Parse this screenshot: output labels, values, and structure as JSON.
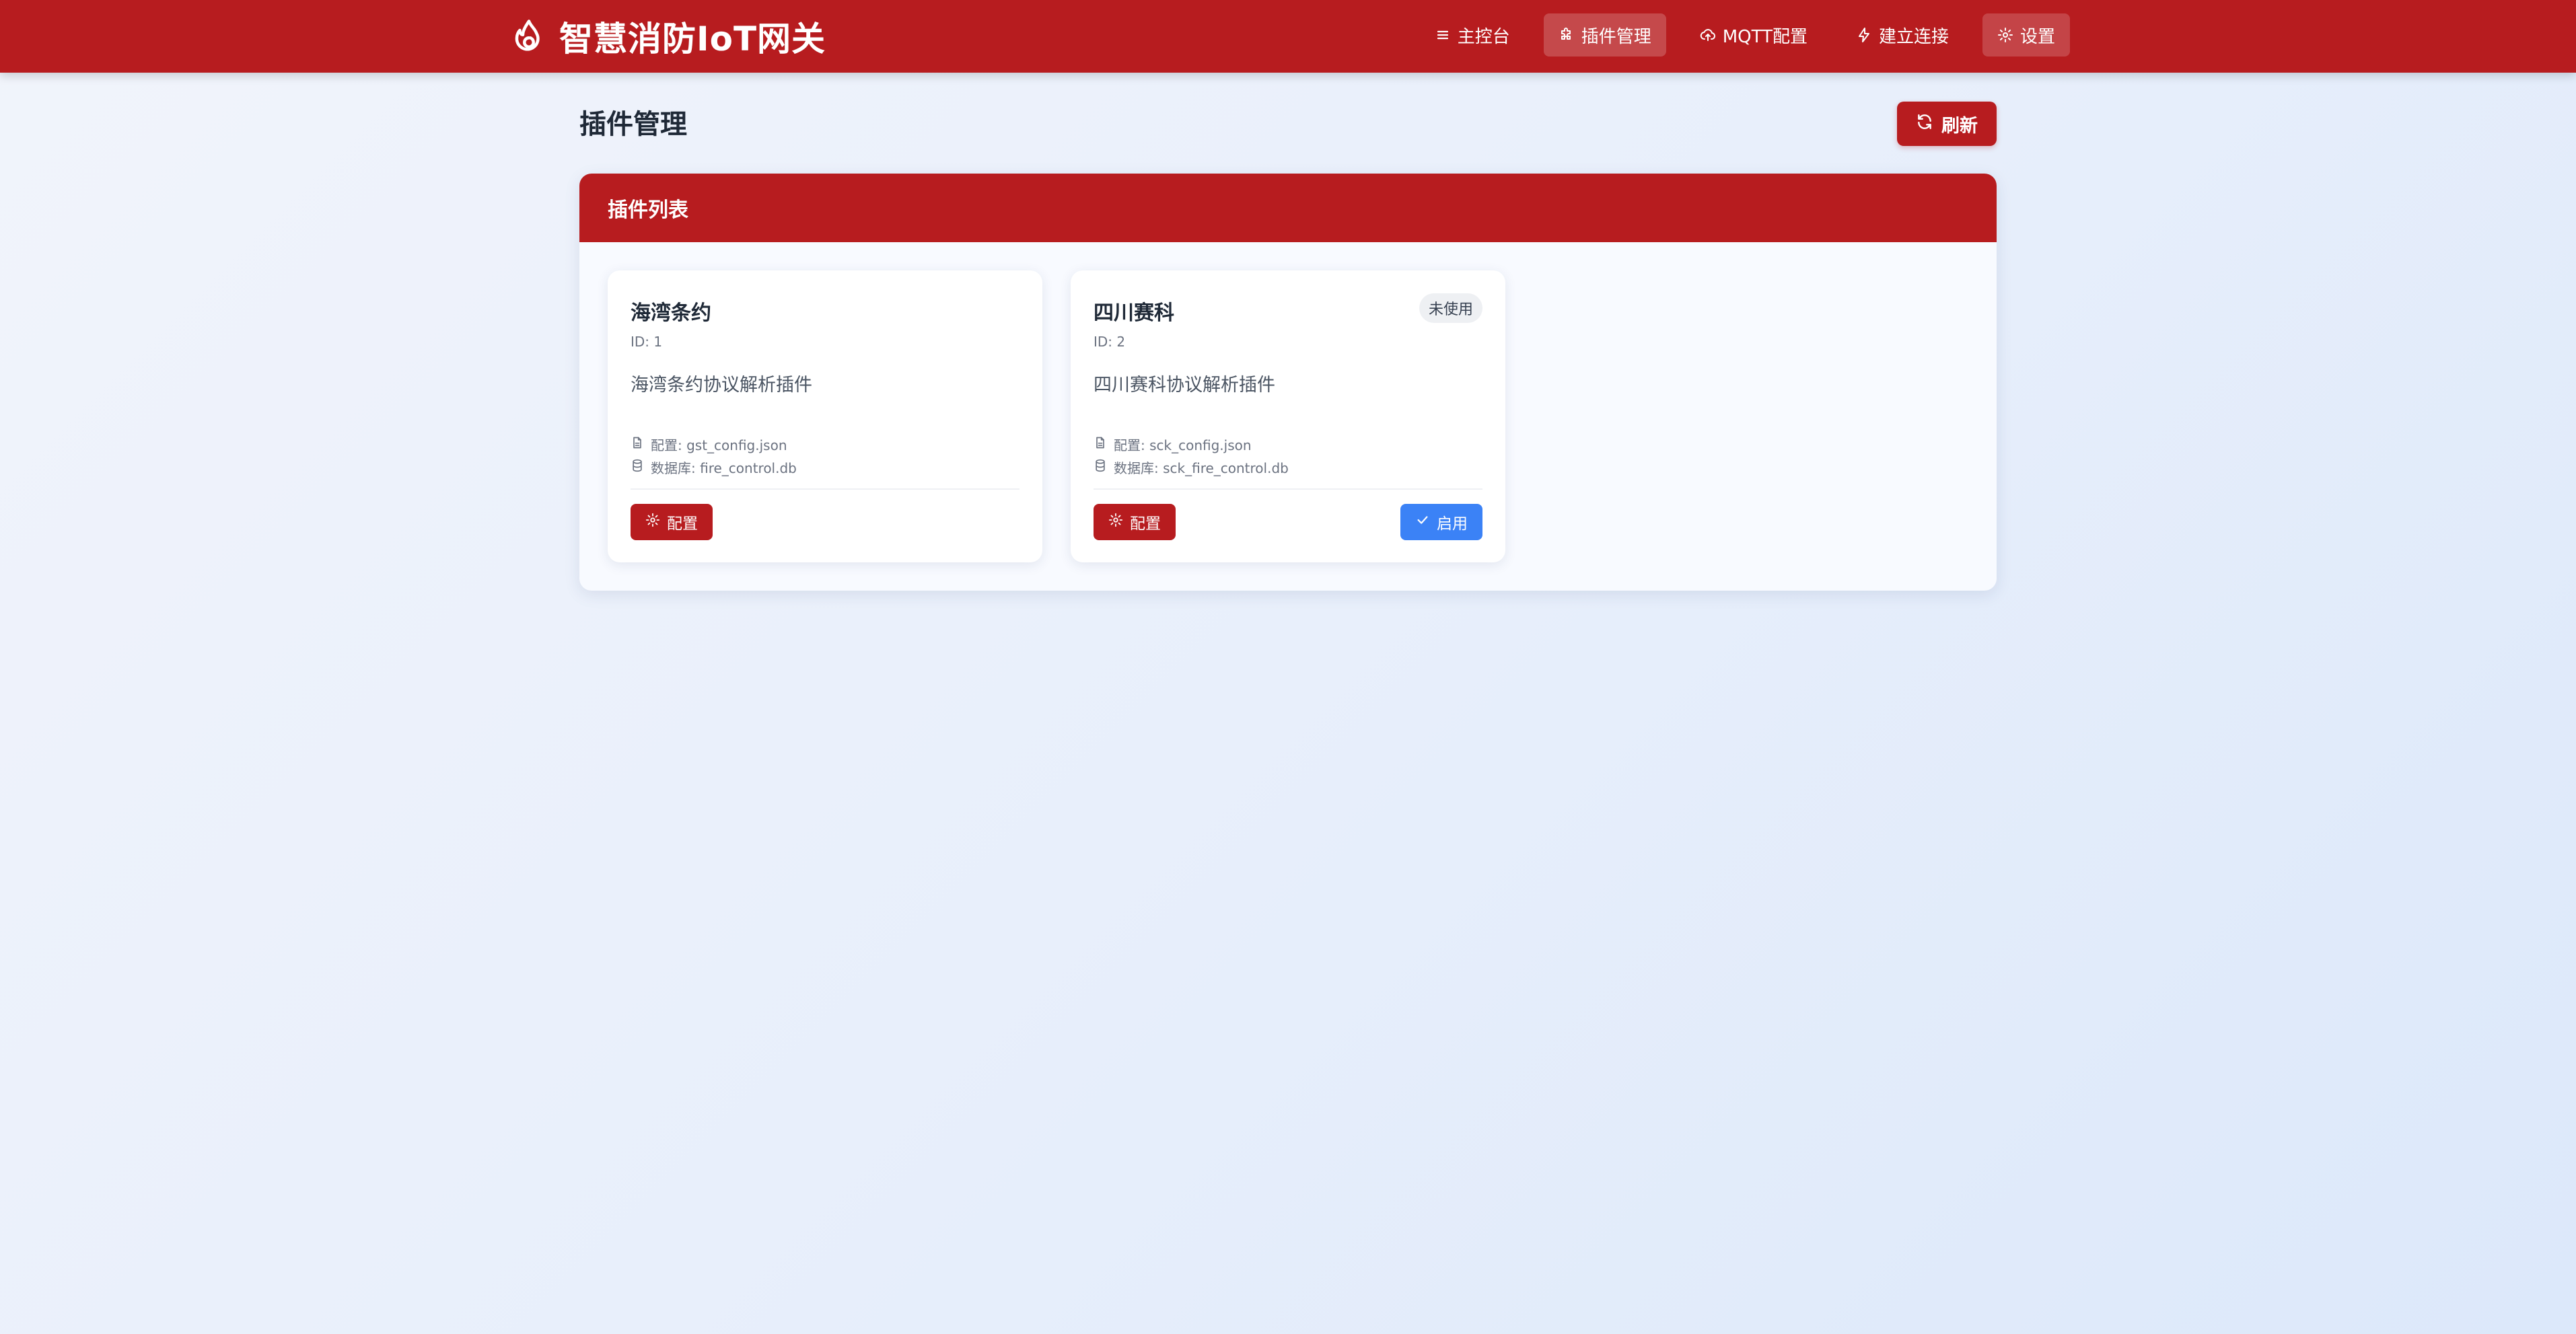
{
  "app": {
    "title": "智慧消防IoT网关",
    "logo_icon": "flame-icon"
  },
  "nav": {
    "items": [
      {
        "label": "主控台",
        "icon": "menu-icon"
      },
      {
        "label": "插件管理",
        "icon": "puzzle-icon",
        "active": true
      },
      {
        "label": "MQTT配置",
        "icon": "cloud-upload-icon"
      },
      {
        "label": "建立连接",
        "icon": "lightning-icon"
      },
      {
        "label": "设置",
        "icon": "gear-icon"
      }
    ]
  },
  "page": {
    "title": "插件管理",
    "refresh_label": "刷新"
  },
  "panel": {
    "title": "插件列表"
  },
  "plugins": [
    {
      "name": "海湾条约",
      "id_text": "ID: 1",
      "description": "海湾条约协议解析插件",
      "config_text": "配置: gst_config.json",
      "db_text": "数据库: fire_control.db",
      "config_button": "配置"
    },
    {
      "name": "四川赛科",
      "badge": "未使用",
      "id_text": "ID: 2",
      "description": "四川赛科协议解析插件",
      "config_text": "配置: sck_config.json",
      "db_text": "数据库: sck_fire_control.db",
      "config_button": "配置",
      "enable_button": "启用"
    }
  ],
  "colors": {
    "primary": "#b71c1f",
    "accent_blue": "#3b82f6"
  }
}
